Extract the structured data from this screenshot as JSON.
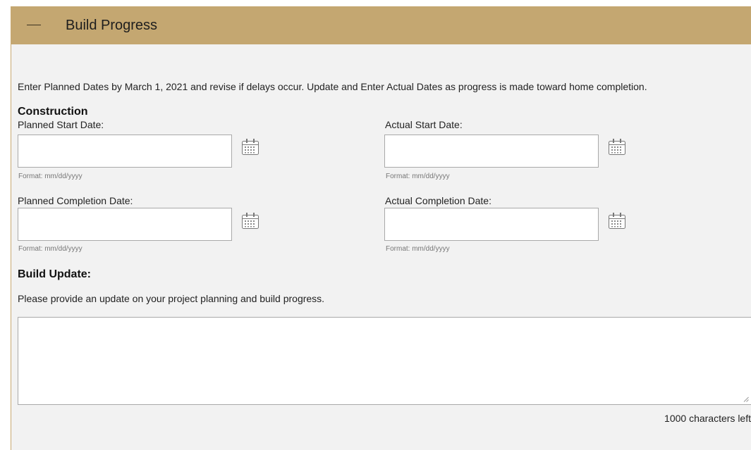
{
  "panel": {
    "title": "Build Progress",
    "collapse_icon": "minus-icon",
    "header_color": "#c4a771"
  },
  "intro_text": "Enter Planned Dates by March 1, 2021 and revise if delays occur. Update and Enter Actual Dates as progress is made toward home completion.",
  "construction": {
    "heading": "Construction",
    "planned_start": {
      "label": "Planned Start Date:",
      "value": "",
      "hint": "Format: mm/dd/yyyy",
      "icon": "calendar-icon"
    },
    "actual_start": {
      "label": "Actual Start Date:",
      "value": "",
      "hint": "Format: mm/dd/yyyy",
      "icon": "calendar-icon"
    },
    "planned_completion": {
      "label": "Planned Completion Date:",
      "value": "",
      "hint": "Format: mm/dd/yyyy",
      "icon": "calendar-icon"
    },
    "actual_completion": {
      "label": "Actual Completion Date:",
      "value": "",
      "hint": "Format: mm/dd/yyyy",
      "icon": "calendar-icon"
    }
  },
  "build_update": {
    "heading": "Build Update:",
    "description": "Please provide an update on your project planning and build progress.",
    "value": "",
    "chars_left": "1000 characters left"
  }
}
